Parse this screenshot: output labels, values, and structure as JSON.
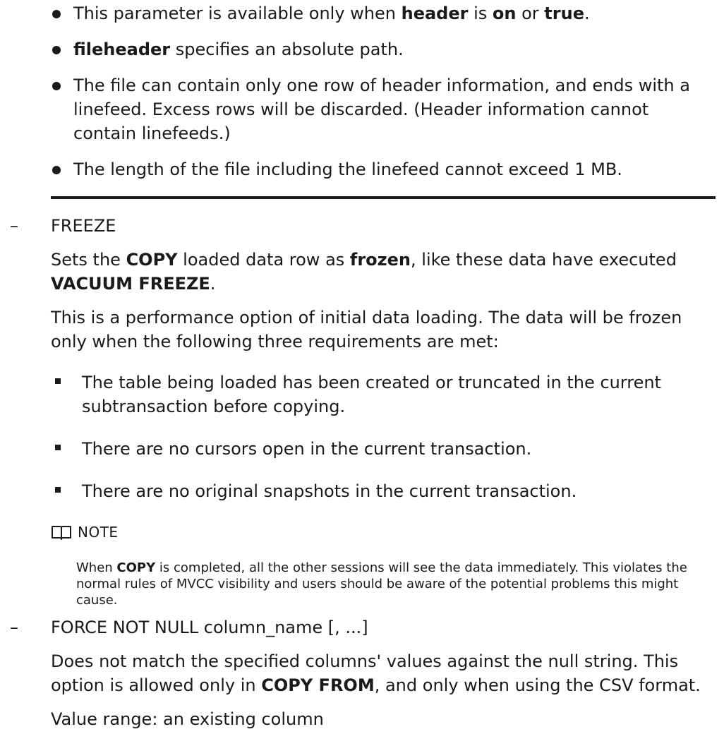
{
  "top_note": {
    "items": [
      {
        "parts": [
          {
            "t": "This parameter is available only when "
          },
          {
            "t": "header",
            "b": true
          },
          {
            "t": " is "
          },
          {
            "t": "on",
            "b": true
          },
          {
            "t": " or "
          },
          {
            "t": "true",
            "b": true
          },
          {
            "t": "."
          }
        ]
      },
      {
        "parts": [
          {
            "t": "fileheader",
            "b": true
          },
          {
            "t": " specifies an absolute path."
          }
        ]
      },
      {
        "parts": [
          {
            "t": "The file can contain only one row of header information, and ends with a linefeed. Excess rows will be discarded. (Header information cannot contain linefeeds.)"
          }
        ]
      },
      {
        "parts": [
          {
            "t": "The length of the file including the linefeed cannot exceed 1 MB."
          }
        ]
      }
    ]
  },
  "freeze": {
    "dash": "–",
    "name": "FREEZE",
    "desc_parts": [
      {
        "t": "Sets the "
      },
      {
        "t": "COPY",
        "b": true
      },
      {
        "t": " loaded data row as "
      },
      {
        "t": "frozen",
        "b": true
      },
      {
        "t": ", like these data have executed "
      },
      {
        "t": "VACUUM FREEZE",
        "b": true
      },
      {
        "t": "."
      }
    ],
    "perf": "This is a performance option of initial data loading. The data will be frozen only when the following three requirements are met:",
    "requirements": [
      "The table being loaded has been created or truncated in the current subtransaction before copying.",
      "There are no cursors open in the current transaction.",
      "There are no original snapshots in the current transaction."
    ],
    "note_title": "NOTE",
    "note_parts": [
      {
        "t": "When "
      },
      {
        "t": "COPY",
        "b": true
      },
      {
        "t": " is completed, all the other sessions will see the data immediately. This violates the normal rules of MVCC visibility and users should be aware of the potential problems this might cause."
      }
    ]
  },
  "force_not_null": {
    "dash": "–",
    "name": "FORCE NOT NULL column_name [, ...]",
    "desc_parts": [
      {
        "t": "Does not match the specified columns' values against the null string. This option is allowed only in "
      },
      {
        "t": "COPY FROM",
        "b": true
      },
      {
        "t": ", and only when using the CSV format."
      }
    ],
    "value_range": "Value range: an existing column"
  }
}
